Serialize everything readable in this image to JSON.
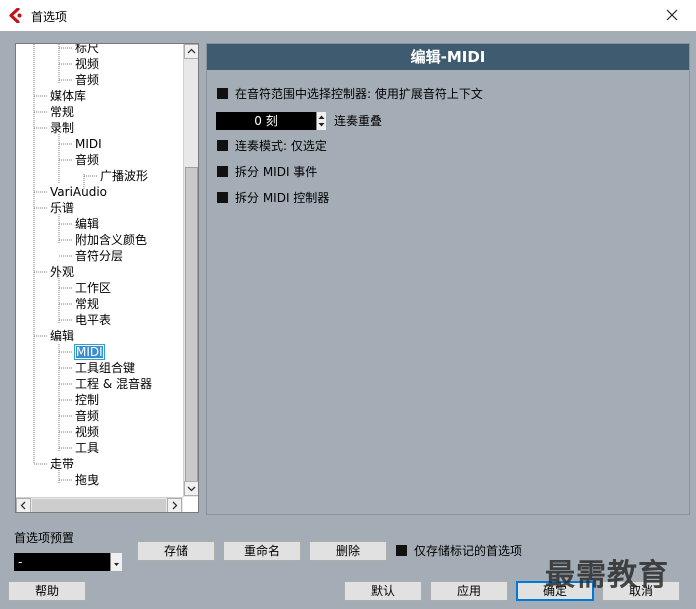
{
  "window": {
    "title": "首选项",
    "close_label": "✕"
  },
  "tree": {
    "items": [
      {
        "label": "标尺",
        "depth": 2
      },
      {
        "label": "视频",
        "depth": 2
      },
      {
        "label": "音频",
        "depth": 2
      },
      {
        "label": "媒体库",
        "depth": 1
      },
      {
        "label": "常规",
        "depth": 1
      },
      {
        "label": "录制",
        "depth": 1
      },
      {
        "label": "MIDI",
        "depth": 2
      },
      {
        "label": "音频",
        "depth": 2
      },
      {
        "label": "广播波形",
        "depth": 3
      },
      {
        "label": "VariAudio",
        "depth": 1
      },
      {
        "label": "乐谱",
        "depth": 1
      },
      {
        "label": "编辑",
        "depth": 2
      },
      {
        "label": "附加含义颜色",
        "depth": 2
      },
      {
        "label": "音符分层",
        "depth": 2
      },
      {
        "label": "外观",
        "depth": 1
      },
      {
        "label": "工作区",
        "depth": 2
      },
      {
        "label": "常规",
        "depth": 2
      },
      {
        "label": "电平表",
        "depth": 2
      },
      {
        "label": "编辑",
        "depth": 1
      },
      {
        "label": "MIDI",
        "depth": 2,
        "selected": true
      },
      {
        "label": "工具组合键",
        "depth": 2
      },
      {
        "label": "工程 & 混音器",
        "depth": 2
      },
      {
        "label": "控制",
        "depth": 2
      },
      {
        "label": "音频",
        "depth": 2
      },
      {
        "label": "视频",
        "depth": 2
      },
      {
        "label": "工具",
        "depth": 2
      },
      {
        "label": "走带",
        "depth": 1
      },
      {
        "label": "拖曳",
        "depth": 2
      }
    ]
  },
  "panel": {
    "title": "编辑-MIDI",
    "option1": "在音符范围中选择控制器: 使用扩展音符上下文",
    "overlap_value": "0 刻",
    "overlap_label": "连奏重叠",
    "option2": "连奏模式: 仅选定",
    "option3": "拆分 MIDI 事件",
    "option4": "拆分 MIDI 控制器"
  },
  "presets": {
    "label": "首选项预置",
    "selected": "-",
    "store": "存储",
    "rename": "重命名",
    "delete": "删除",
    "store_marked_only": "仅存储标记的首选项"
  },
  "footer": {
    "help": "帮助",
    "default": "默认",
    "apply": "应用",
    "ok": "确定",
    "cancel": "取消"
  },
  "watermark": "最需教育",
  "colors": {
    "header": "#3f5b6f",
    "panel_bg": "#a4adb6",
    "focus": "#0078d7"
  }
}
